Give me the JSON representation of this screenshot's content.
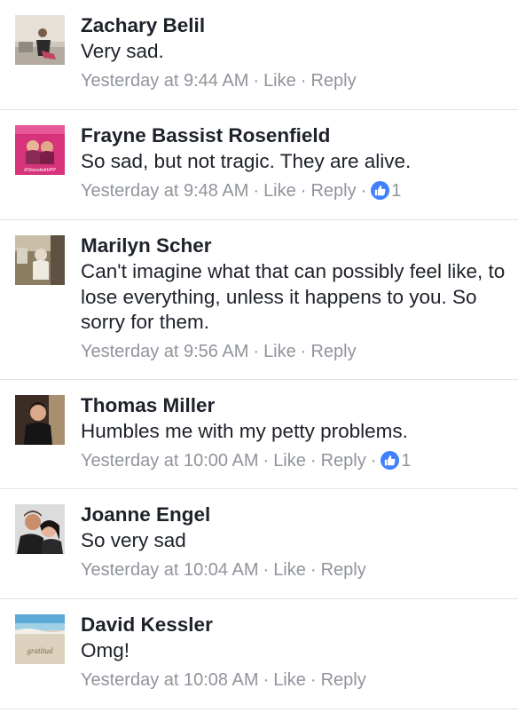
{
  "comments": [
    {
      "name": "Zachary Belil",
      "text": "Very sad.",
      "time": "Yesterday at 9:44 AM",
      "like_label": "Like",
      "reply_label": "Reply",
      "likes": null,
      "avatar": "avatar-zachary"
    },
    {
      "name": "Frayne Bassist Rosenfield",
      "text": "So sad, but not tragic.  They are alive.",
      "time": "Yesterday at 9:48 AM",
      "like_label": "Like",
      "reply_label": "Reply",
      "likes": "1",
      "avatar": "avatar-frayne",
      "avatar_text": "#IStandwithPP"
    },
    {
      "name": "Marilyn Scher",
      "text": "Can't imagine what that can possibly feel like, to lose everything, unless it happens to you. So sorry for them.",
      "time": "Yesterday at 9:56 AM",
      "like_label": "Like",
      "reply_label": "Reply",
      "likes": null,
      "avatar": "avatar-marilyn"
    },
    {
      "name": "Thomas Miller",
      "text": "Humbles me with my petty problems.",
      "time": "Yesterday at 10:00 AM",
      "like_label": "Like",
      "reply_label": "Reply",
      "likes": "1",
      "avatar": "avatar-thomas"
    },
    {
      "name": "Joanne Engel",
      "text": "So very sad",
      "time": "Yesterday at 10:04 AM",
      "like_label": "Like",
      "reply_label": "Reply",
      "likes": null,
      "avatar": "avatar-joanne"
    },
    {
      "name": "David Kessler",
      "text": "Omg!",
      "time": "Yesterday at 10:08 AM",
      "like_label": "Like",
      "reply_label": "Reply",
      "likes": null,
      "avatar": "avatar-david",
      "avatar_text": "gratitud"
    }
  ],
  "separator": "·",
  "colors": {
    "link_blue": "#4080ff",
    "meta_gray": "#90949c",
    "text": "#1d2129"
  }
}
